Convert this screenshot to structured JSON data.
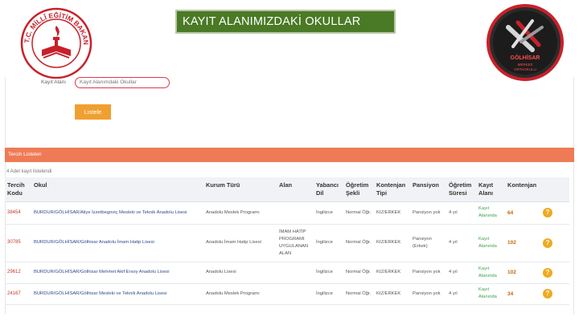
{
  "header": {
    "title": "KAYIT ALANIMIZDAKİ OKULLAR",
    "left_logo_text": "T.C. MİLLÎ EĞİTİM BAKANLIĞI",
    "right_logo_text": "GÖLHİSAR MERKEZ ORTAOKULU"
  },
  "filter": {
    "label": "Kayıt Alanı",
    "value": "Kayıt Alanımdaki Okullar",
    "button": "Listele"
  },
  "panel": {
    "title": "Tercih Listeleri",
    "record_count": "4 Adet kayıt listelendi"
  },
  "table": {
    "headers": [
      "Tercih Kodu",
      "Okul",
      "Kurum Türü",
      "Alan",
      "Yabancı Dil",
      "Öğretim Şekli",
      "Kontenjan Tipi",
      "Pansiyon",
      "Öğretim Süresi",
      "Kayıt Alanı",
      "Kontenjan",
      ""
    ],
    "rows": [
      {
        "code": "38454",
        "school": "BURDUR/GÖLHİSAR/Aliye İzzetbegoviç Mesleki ve Teknik Anadolu Lisesi",
        "kurum": "Anadolu Meslek Programı",
        "alan": "",
        "dil": "İngilizce",
        "sekil": "Normal Öğr.",
        "tip": "KIZ/ERKEK",
        "pansiyon": "Pansiyon yok",
        "sure": "4 yıl",
        "kayit": "Kayıt Alanında",
        "kontenjan": "64",
        "help": "?"
      },
      {
        "code": "30785",
        "school": "BURDUR/GÖLHİSAR/Gölhisar Anadolu İmam Hatip Lisesi",
        "kurum": "Anadolu İmam Hatip Lisesi",
        "alan": "İMAM HATİP PROGRAMI UYGULANAN ALAN",
        "dil": "İngilizce",
        "sekil": "Normal Öğr.",
        "tip": "KIZ/ERKEK",
        "pansiyon": "Pansiyon (Erkek)",
        "sure": "4 yıl",
        "kayit": "Kayıt Alanında",
        "kontenjan": "102",
        "help": "?"
      },
      {
        "code": "29612",
        "school": "BURDUR/GÖLHİSAR/Gölhisar Mehmet Akif Ersoy Anadolu Lisesi",
        "kurum": "Anadolu Lisesi",
        "alan": "",
        "dil": "İngilizce",
        "sekil": "Normal Öğr.",
        "tip": "KIZ/ERKEK",
        "pansiyon": "Pansiyon yok",
        "sure": "4 yıl",
        "kayit": "Kayıt Alanında",
        "kontenjan": "102",
        "help": "?"
      },
      {
        "code": "24167",
        "school": "BURDUR/GÖLHİSAR/Gölhisar Mesleki ve Teknik Anadolu Lisesi",
        "kurum": "Anadolu Meslek Programı",
        "alan": "",
        "dil": "İngilizce",
        "sekil": "Normal Öğr.",
        "tip": "KIZ/ERKEK",
        "pansiyon": "Pansiyon yok",
        "sure": "4 yıl",
        "kayit": "Kayıt Alanında",
        "kontenjan": "34",
        "help": "?"
      }
    ]
  },
  "colors": {
    "title_bg": "#4a7a25",
    "panel_orange": "#ef7b56",
    "button_orange": "#f0a030",
    "help_orange": "#f1a91e",
    "code_red": "#c0392b",
    "link_green": "#3aa34a"
  }
}
